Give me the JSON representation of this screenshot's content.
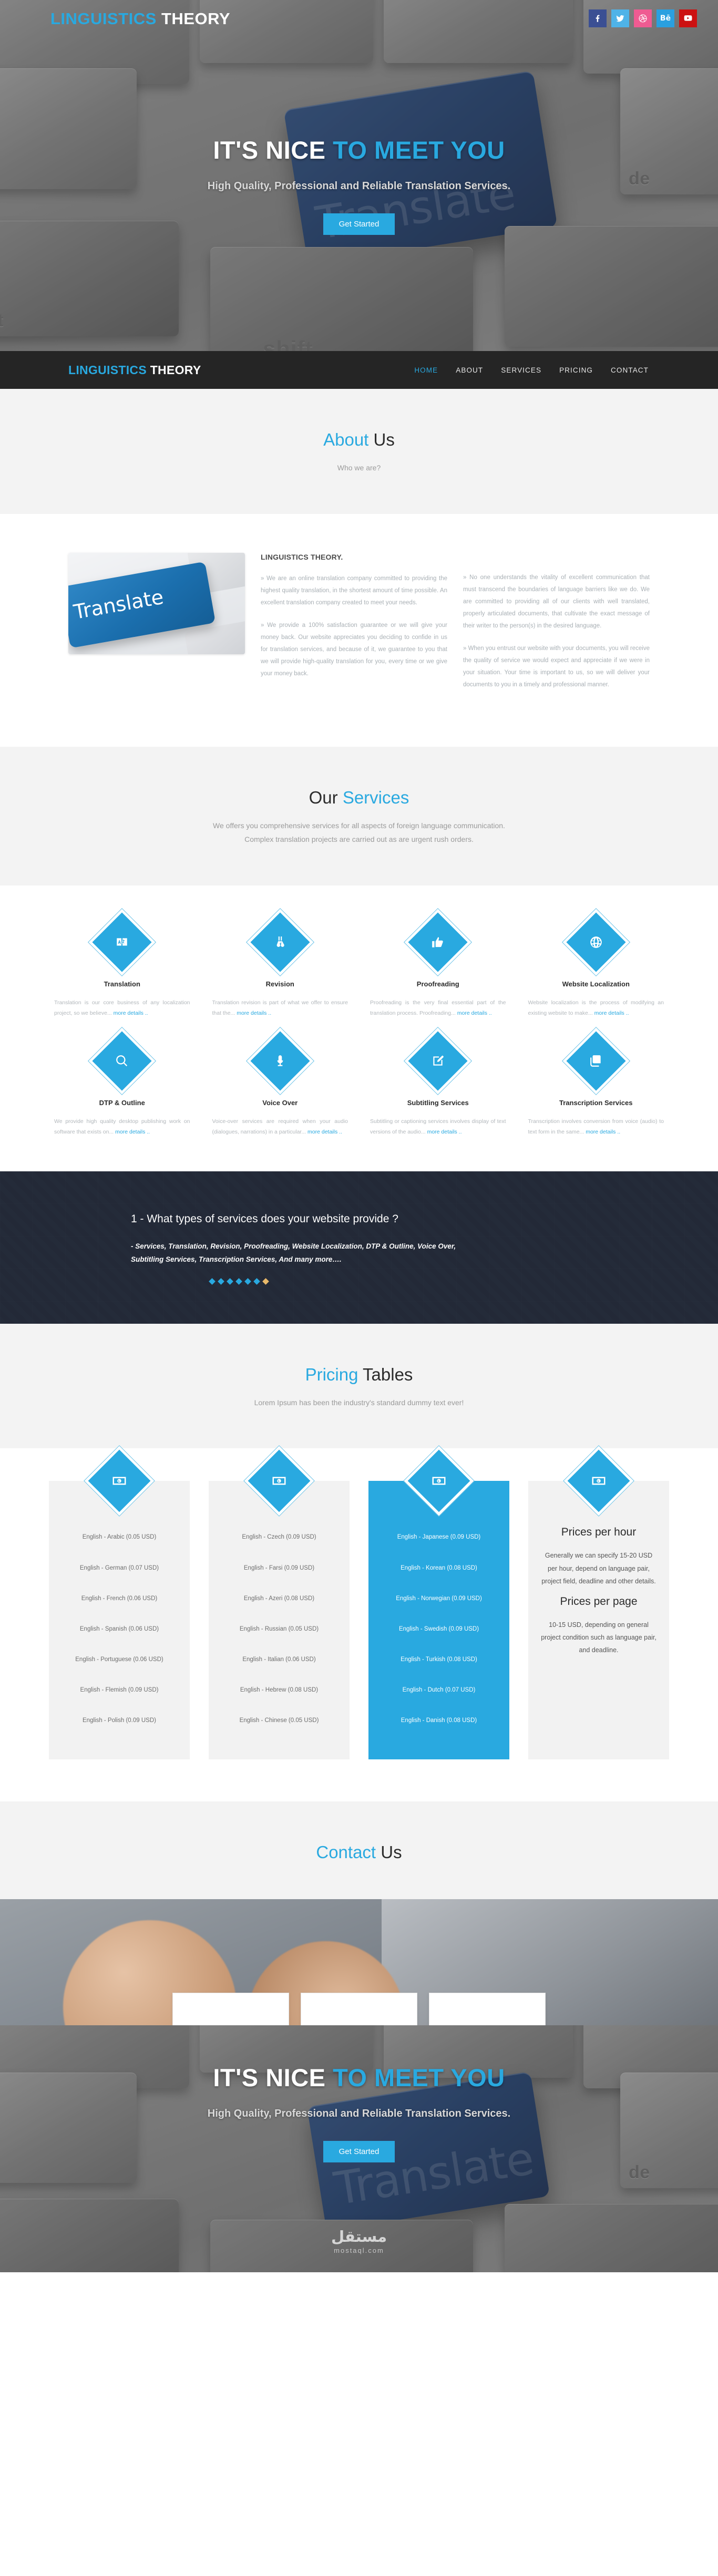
{
  "brand": {
    "part1": "LINGUISTICS",
    "part2": "THEORY",
    "accent": "#29a9e0"
  },
  "social": [
    {
      "name": "facebook",
      "label": "f",
      "color": "#3b4f93"
    },
    {
      "name": "twitter",
      "label": "t",
      "color": "#4fb3e8"
    },
    {
      "name": "dribbble",
      "label": "d",
      "color": "#ef5b92"
    },
    {
      "name": "behance",
      "label": "Bē",
      "color": "#2aa0e0"
    },
    {
      "name": "youtube",
      "label": "y",
      "color": "#cc1111"
    }
  ],
  "hero": {
    "title_white": "IT'S NICE",
    "title_blue": "TO MEET YOU",
    "subtitle": "High Quality, Professional and Reliable Translation Services.",
    "cta": "Get Started",
    "key_labels": [
      "?",
      "alt",
      "shift",
      "de"
    ]
  },
  "nav": {
    "items": [
      {
        "label": "HOME",
        "active": true
      },
      {
        "label": "ABOUT",
        "active": false
      },
      {
        "label": "SERVICES",
        "active": false
      },
      {
        "label": "PRICING",
        "active": false
      },
      {
        "label": "CONTACT",
        "active": false
      }
    ]
  },
  "about": {
    "title_blue": "About",
    "title_dark": "Us",
    "subtitle": "Who we are?",
    "heading": "LINGUISTICS THEORY.",
    "p1": "» We are an online translation company committed to providing the highest quality translation, in the shortest amount of time possible. An excellent translation company created to meet your needs.",
    "p2": "» We provide a 100% satisfaction guarantee or we will give your money back. Our website appreciates you deciding to confide in us for translation services, and because of it, we guarantee to you that we will provide high-quality translation for you, every time or we give your money back.",
    "p3": "» No one understands the vitality of excellent communication that must transcend the boundaries of language barriers like we do. We are committed to providing all of our clients with well translated, properly articulated documents, that cultivate the exact message of their writer to the person(s) in the desired language.",
    "p4": "» When you entrust our website with your documents, you will receive the quality of service we would expect and appreciate if we were in your situation. Your time is important to us, so we will deliver your documents to you in a timely and professional manner.",
    "image_word": "Translate"
  },
  "services": {
    "title_dark": "Our",
    "title_blue": "Services",
    "subtitle_line1": "We offers you comprehensive services for all aspects of foreign language communication.",
    "subtitle_line2": "Complex translation projects are carried out as are urgent rush orders.",
    "more_label": "more details ..",
    "items": [
      {
        "icon": "book-translate-icon",
        "title": "Translation",
        "desc": "Translation is our core business of any localization project, so we believe..."
      },
      {
        "icon": "binoculars-icon",
        "title": "Revision",
        "desc": "Translation revision is part of what we offer to ensure that the..."
      },
      {
        "icon": "thumbs-up-icon",
        "title": "Proofreading",
        "desc": "Proofreading is the very final essential part of the translation process. Proofreading..."
      },
      {
        "icon": "globe-icon",
        "title": "Website Localization",
        "desc": "Website localization is the process of modifying an existing website to make..."
      },
      {
        "icon": "search-icon",
        "title": "DTP & Outline",
        "desc": "We provide high quality desktop publishing work on software that exists on..."
      },
      {
        "icon": "microphone-icon",
        "title": "Voice Over",
        "desc": "Voice-over services are required when your audio (dialogues, narrations) in a particular..."
      },
      {
        "icon": "pencil-square-icon",
        "title": "Subtitling Services",
        "desc": "Subtitling or captioning services involves display of text versions of the audio..."
      },
      {
        "icon": "layers-icon",
        "title": "Transcription Services",
        "desc": "Transcription involves conversion from voice (audio) to text form in the same..."
      }
    ]
  },
  "faq": {
    "question": "1 - What types of services does your website provide ?",
    "answer": "- Services, Translation, Revision, Proofreading, Website Localization, DTP & Outline, Voice Over, Subtitling Services, Transcription Services, And many more….",
    "dots": 7,
    "active_dot": 6
  },
  "pricing": {
    "title_blue": "Pricing",
    "title_dark": "Tables",
    "subtitle": "Lorem Ipsum has been the industry's standard dummy text ever!",
    "icon": "banknote-icon",
    "columns": [
      {
        "highlight": false,
        "rows": [
          "English - Arabic (0.05 USD)",
          "English - German (0.07 USD)",
          "English - French (0.06 USD)",
          "English - Spanish (0.06 USD)",
          "English - Portuguese (0.06 USD)",
          "English - Flemish (0.09 USD)",
          "English - Polish (0.09 USD)"
        ]
      },
      {
        "highlight": false,
        "rows": [
          "English - Czech (0.09 USD)",
          "English - Farsi (0.09 USD)",
          "English - Azeri (0.08 USD)",
          "English - Russian (0.05 USD)",
          "English - Italian (0.06 USD)",
          "English - Hebrew (0.08 USD)",
          "English - Chinese (0.05 USD)"
        ]
      },
      {
        "highlight": true,
        "rows": [
          "English - Japanese (0.09 USD)",
          "English - Korean (0.08 USD)",
          "English - Norwegian (0.09 USD)",
          "English - Swedish (0.09 USD)",
          "English - Turkish (0.08 USD)",
          "English - Dutch (0.07 USD)",
          "English - Danish (0.08 USD)"
        ]
      }
    ],
    "info": {
      "h1": "Prices per hour",
      "p1": "Generally we can specify 15-20 USD per hour, depend on language pair, project field, deadline and other details.",
      "h2": "Prices per page",
      "p2": "10-15 USD, depending on general project condition such as language pair, and deadline."
    }
  },
  "contact": {
    "title_blue": "Contact",
    "title_dark": "Us"
  },
  "footer_hero": {
    "title_white": "IT'S NICE",
    "title_blue": "TO MEET YOU",
    "subtitle": "High Quality, Professional and Reliable Translation Services.",
    "cta": "Get Started",
    "watermark_ar": "مستقل",
    "watermark_en": "mostaql.com"
  }
}
